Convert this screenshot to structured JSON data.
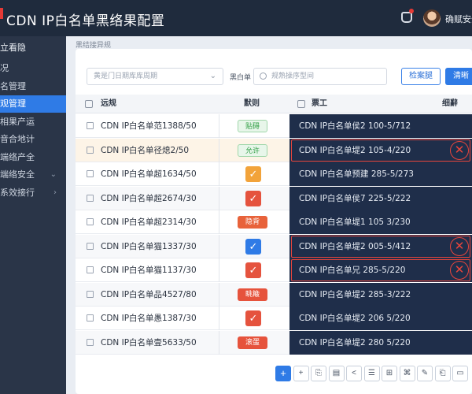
{
  "header": {
    "title": "CDN IP白名单黑络果配置",
    "user_name": "确赋安全",
    "icons": {
      "bell": "bell-icon",
      "avatar": "user-avatar"
    }
  },
  "sidebar": {
    "heading": "立看隐",
    "items": [
      {
        "label": "况"
      },
      {
        "label": "名管理"
      },
      {
        "label": "观管理",
        "active": true
      },
      {
        "label": "相果产运"
      },
      {
        "label": "音合地计"
      },
      {
        "label": "端络产全"
      },
      {
        "label": "端络安全",
        "chevron": "⌄"
      },
      {
        "label": "系效接行",
        "chevron": "›"
      }
    ]
  },
  "breadcrumb": "黑结接异规",
  "filters": {
    "select_placeholder": "黄是门日期库库周期",
    "label": "黑白单",
    "search_placeholder": "规熟操序型间",
    "query_button": "检案腿",
    "clear_button": "清晰"
  },
  "table": {
    "headers": {
      "name": "远规",
      "status": "默则",
      "target": "票工",
      "action": "细辭"
    },
    "rows": [
      {
        "name": "CDN IP白名单范1388/50",
        "status": "贴碍",
        "status_kind": "green-tag",
        "target": "CDN IP白名单侯2 100-5/712",
        "highlight": false,
        "alert": false
      },
      {
        "name": "CDN IP白名单径熄2/50",
        "status": "允许",
        "status_kind": "green-tag",
        "target": "CDN IP白名单堤2 105-4/220",
        "highlight": true,
        "alert": true
      },
      {
        "name": "CDN IP白名单超1634/50",
        "status": "",
        "status_kind": "orange-check",
        "target": "CDN IP白名单预建 285-5/273",
        "highlight": false,
        "alert": false
      },
      {
        "name": "CDN IP白名单超2674/30",
        "status": "",
        "status_kind": "red-check",
        "target": "CDN IP白名单侯7 225-5/222",
        "highlight": false,
        "alert": false
      },
      {
        "name": "CDN IP白名单超2314/30",
        "status": "隐背",
        "status_kind": "orange-tag",
        "target": "CDN IP白名单堤1 105 3/230",
        "highlight": false,
        "alert": false
      },
      {
        "name": "CDN IP白名单猫1337/30",
        "status": "",
        "status_kind": "blue-check",
        "target": "CDN IP白名单堤2 005-5/412",
        "highlight": false,
        "alert": true
      },
      {
        "name": "CDN IP白名单猫1137/30",
        "status": "",
        "status_kind": "red-check",
        "target": "CDN IP白名单兄 285-5/220",
        "highlight": false,
        "alert": true
      },
      {
        "name": "CDN IP白名单品4527/80",
        "status": "眺簸",
        "status_kind": "red-tag",
        "target": "CDN IP白名单堤2 285-3/222",
        "highlight": false,
        "alert": false
      },
      {
        "name": "CDN IP白名单愚1387/30",
        "status": "",
        "status_kind": "red-check",
        "target": "CDN IP白名单堤2 206 5/220",
        "highlight": false,
        "alert": false
      },
      {
        "name": "CDN IP白名单壹5633/50",
        "status": "滚蛋",
        "status_kind": "red-tag",
        "target": "CDN IP白名单堤2 280 5/220",
        "highlight": false,
        "alert": false
      }
    ]
  },
  "toolbar": {
    "tools": [
      "plus-primary-icon",
      "plus-icon",
      "copy-icon",
      "grid-icon",
      "back-icon",
      "list-icon",
      "tree-icon",
      "link-icon",
      "edit-icon",
      "paste-icon",
      "window-icon"
    ],
    "glyphs": [
      "+",
      "+",
      "⎘",
      "▤",
      "<",
      "☰",
      "⊞",
      "⌘",
      "✎",
      "⎗",
      "▭"
    ]
  },
  "colors": {
    "header_bg": "#1f2b3d",
    "sidebar_bg": "#2a3548",
    "accent": "#2f7be6",
    "alert": "#e8453c",
    "dark_column": "#1f2e4a"
  }
}
